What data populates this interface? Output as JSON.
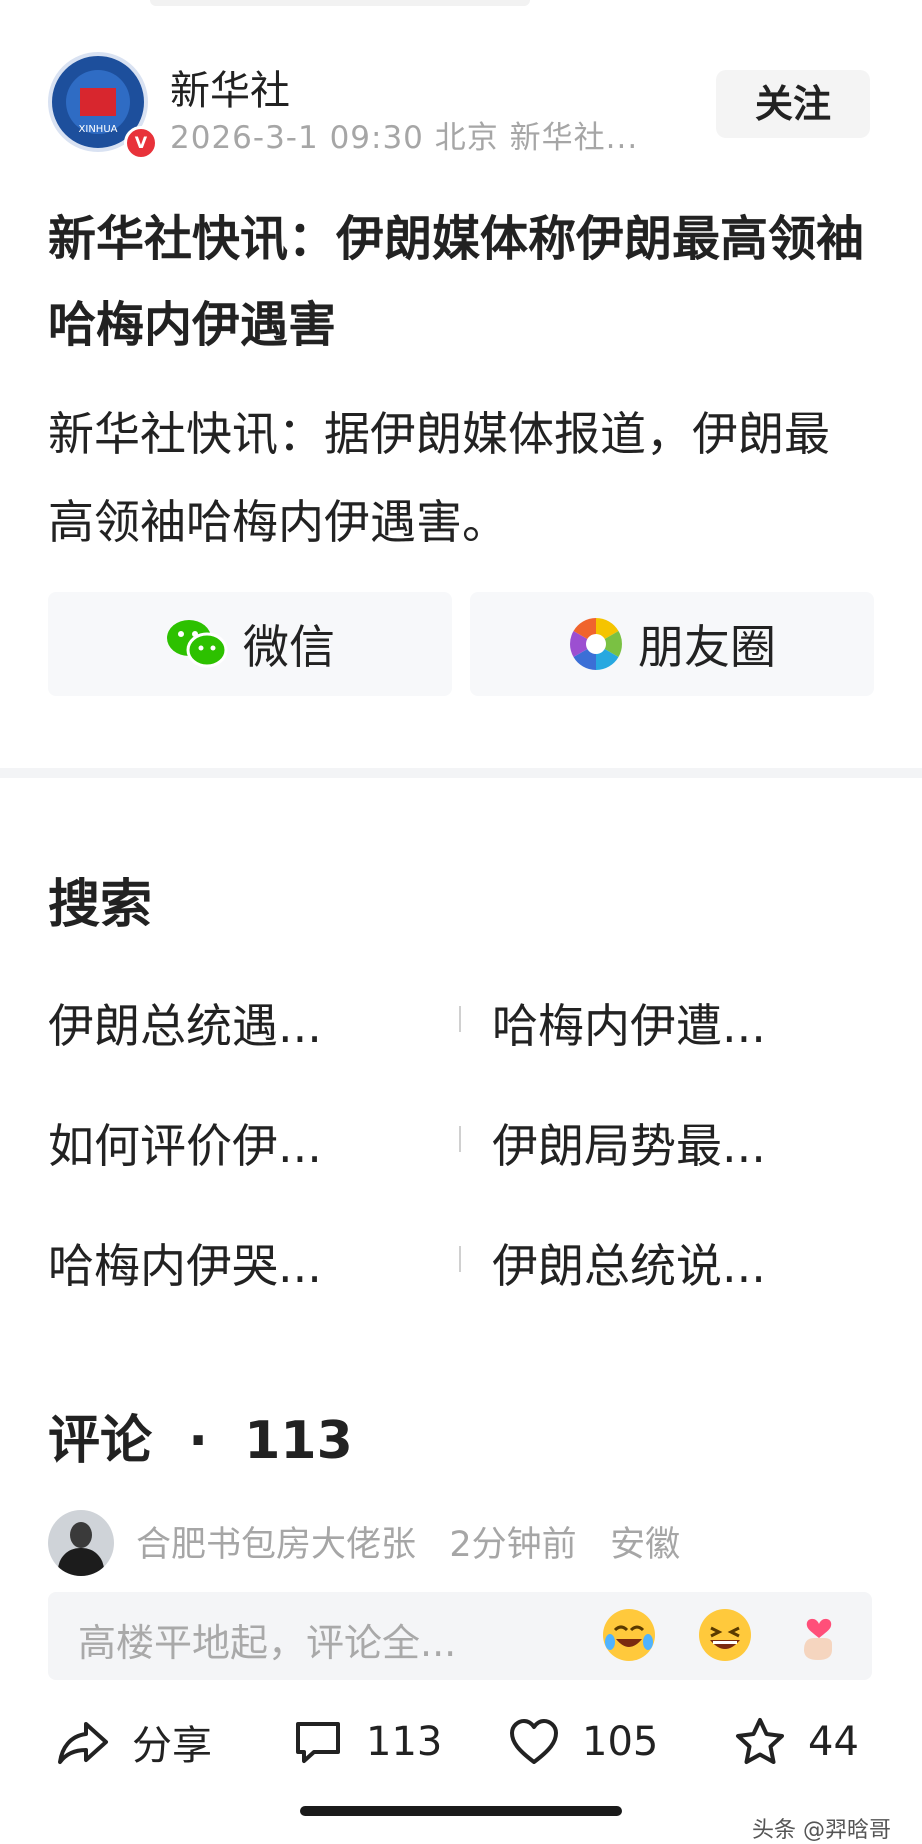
{
  "author": {
    "name": "新华社",
    "meta": "2026-3-1 09:30  北京  新华社...",
    "logo_text": "XINHUA",
    "verified_mark": "V",
    "follow_label": "关注"
  },
  "article": {
    "headline": "新华社快讯：伊朗媒体称伊朗最高领袖哈梅内伊遇害",
    "body": "新华社快讯：据伊朗媒体报道，伊朗最高领袖哈梅内伊遇害。"
  },
  "share": {
    "wechat_label": "微信",
    "moments_label": "朋友圈"
  },
  "search": {
    "title": "搜索",
    "suggestions": [
      "伊朗总统遇...",
      "哈梅内伊遭...",
      "如何评价伊...",
      "伊朗局势最...",
      "哈梅内伊哭...",
      "伊朗总统说..."
    ]
  },
  "comments": {
    "title": "评论",
    "count": "113",
    "first": {
      "user": "合肥书包房大佬张",
      "time": "2分钟前",
      "location": "安徽"
    },
    "input_placeholder": "高楼平地起，评论全..."
  },
  "bottom_bar": {
    "share_label": "分享",
    "comment_count": "113",
    "like_count": "105",
    "favorite_count": "44"
  },
  "watermark": "头条 @羿晗哥",
  "icons": [
    "wechat-icon",
    "moments-icon",
    "share-icon",
    "comment-icon",
    "heart-icon",
    "star-icon",
    "laugh-cry-emoji",
    "grin-emoji",
    "finger-heart-emoji"
  ],
  "colors": {
    "accent_red": "#e8323a",
    "brand_blue": "#1d4f9c",
    "wechat_green": "#2dc100"
  }
}
